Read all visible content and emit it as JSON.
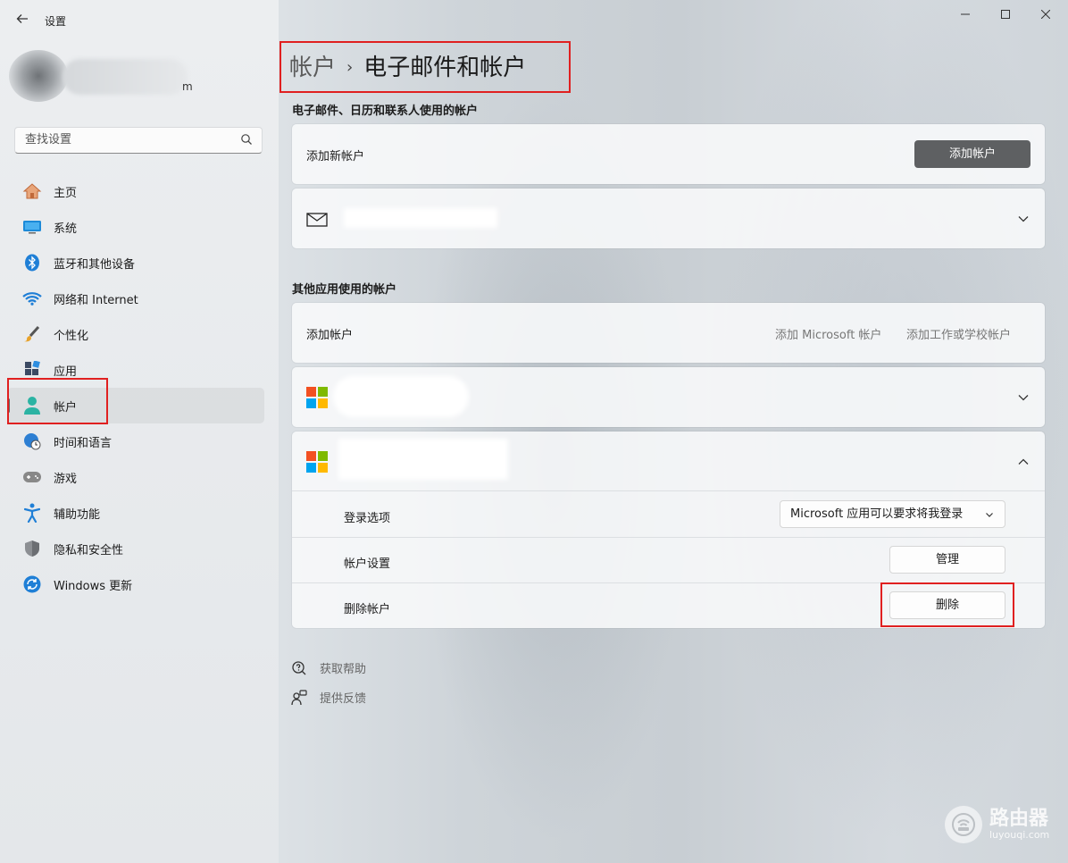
{
  "window": {
    "title": "设置",
    "controls": [
      "minimize",
      "maximize",
      "close"
    ]
  },
  "profile": {
    "name_suffix": "m"
  },
  "search": {
    "placeholder": "查找设置",
    "icon": "search-icon"
  },
  "sidebar": {
    "items": [
      {
        "label": "主页",
        "icon": "home-icon"
      },
      {
        "label": "系统",
        "icon": "system-icon"
      },
      {
        "label": "蓝牙和其他设备",
        "icon": "bluetooth-icon"
      },
      {
        "label": "网络和 Internet",
        "icon": "wifi-icon"
      },
      {
        "label": "个性化",
        "icon": "brush-icon"
      },
      {
        "label": "应用",
        "icon": "apps-icon"
      },
      {
        "label": "帐户",
        "icon": "account-icon",
        "selected": true
      },
      {
        "label": "时间和语言",
        "icon": "globe-clock-icon"
      },
      {
        "label": "游戏",
        "icon": "gamepad-icon"
      },
      {
        "label": "辅助功能",
        "icon": "accessibility-icon"
      },
      {
        "label": "隐私和安全性",
        "icon": "shield-icon"
      },
      {
        "label": "Windows 更新",
        "icon": "update-icon"
      }
    ]
  },
  "breadcrumb": {
    "parent": "帐户",
    "separator": "›",
    "current": "电子邮件和帐户"
  },
  "email_section": {
    "title": "电子邮件、日历和联系人使用的帐户",
    "add_row_label": "添加新帐户",
    "add_button": "添加帐户",
    "mail_icon": "mail-icon"
  },
  "other_section": {
    "title": "其他应用使用的帐户",
    "add_row_label": "添加帐户",
    "add_ms_link": "添加 Microsoft 帐户",
    "add_work_link": "添加工作或学校帐户"
  },
  "expanded_account": {
    "signin_label": "登录选项",
    "signin_value": "Microsoft 应用可以要求将我登录",
    "settings_label": "帐户设置",
    "settings_button": "管理",
    "remove_label": "删除帐户",
    "remove_button": "删除"
  },
  "help": {
    "get_help": "获取帮助",
    "feedback": "提供反馈"
  },
  "watermark": {
    "name": "路由器",
    "site": "luyouqi.com"
  },
  "colors": {
    "highlight": "#e02020",
    "ms_red": "#f25022",
    "ms_green": "#7fba00",
    "ms_blue": "#00a4ef",
    "ms_yellow": "#ffb900",
    "accent": "#0067c0"
  }
}
